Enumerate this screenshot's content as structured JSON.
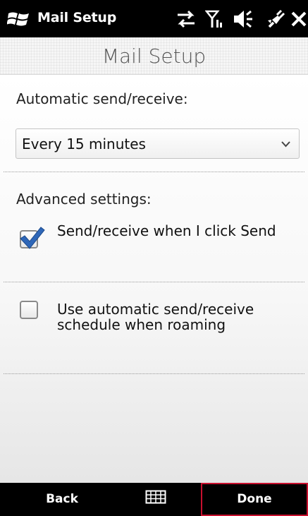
{
  "status_bar": {
    "app_title": "Mail Setup",
    "icons": [
      "windows-logo-icon",
      "data-connection-icon",
      "signal-icon",
      "volume-icon",
      "power-plug-icon",
      "close-icon"
    ]
  },
  "header": {
    "title": "Mail Setup"
  },
  "main": {
    "auto_label": "Automatic send/receive:",
    "interval_select": {
      "selected": "Every 15 minutes"
    },
    "advanced_label": "Advanced settings:",
    "options": [
      {
        "label": "Send/receive when I click Send",
        "checked": true
      },
      {
        "label": "Use automatic send/receive schedule when roaming",
        "checked": false
      }
    ]
  },
  "bottom_bar": {
    "left_label": "Back",
    "center_icon": "keyboard-icon",
    "right_label": "Done"
  },
  "colors": {
    "checkmark": "#2f67b8",
    "done_border": "#c8102e"
  }
}
